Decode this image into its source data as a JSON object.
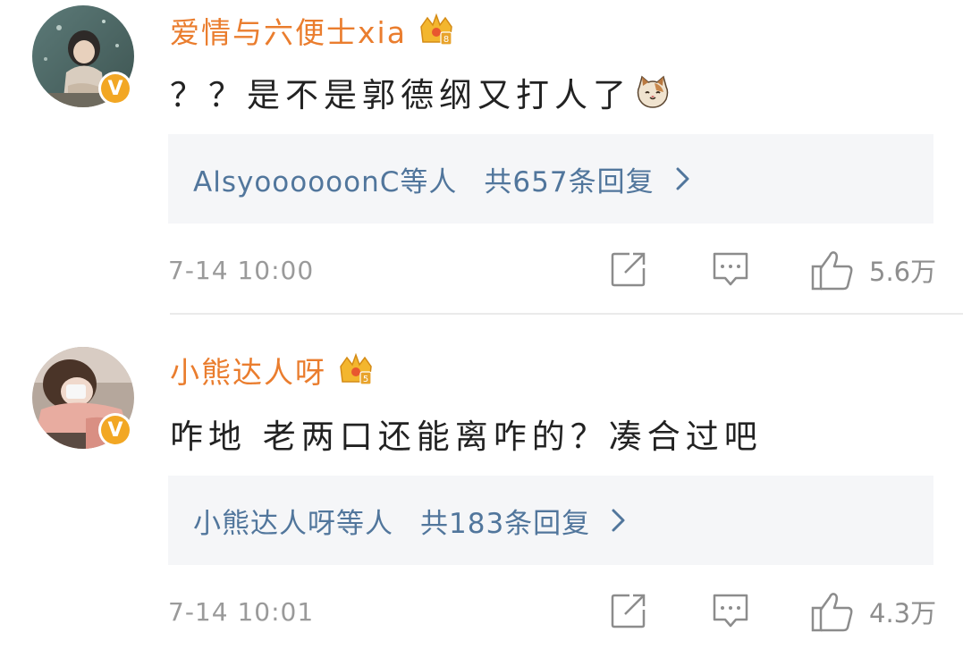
{
  "comments": [
    {
      "username": "爱情与六便士xia",
      "text": "？？是不是郭德纲又打人了",
      "emoji": "cat-face",
      "reply_names": "AlsyoooooonC等人",
      "reply_count": "共657条回复",
      "timestamp": "7-14 10:00",
      "likes": "5.6万",
      "level_badge": "8"
    },
    {
      "username": "小熊达人呀",
      "text": "咋地 老两口还能离咋的？凑合过吧",
      "reply_names": "小熊达人呀等人",
      "reply_count": "共183条回复",
      "timestamp": "7-14 10:01",
      "likes": "4.3万",
      "level_badge": "5"
    }
  ],
  "colors": {
    "username": "#ea7d2e",
    "link": "#51769c",
    "text": "#222222",
    "meta": "#9a9a9a",
    "reply_bg": "#f5f6f8",
    "verified": "#f2a724",
    "crown": "#f3b62e"
  },
  "icons": {
    "verified": "V",
    "share": "share-icon",
    "comment": "comment-icon",
    "like": "thumbs-up-icon",
    "chevron": "chevron-right-icon",
    "crown": "crown-icon"
  }
}
